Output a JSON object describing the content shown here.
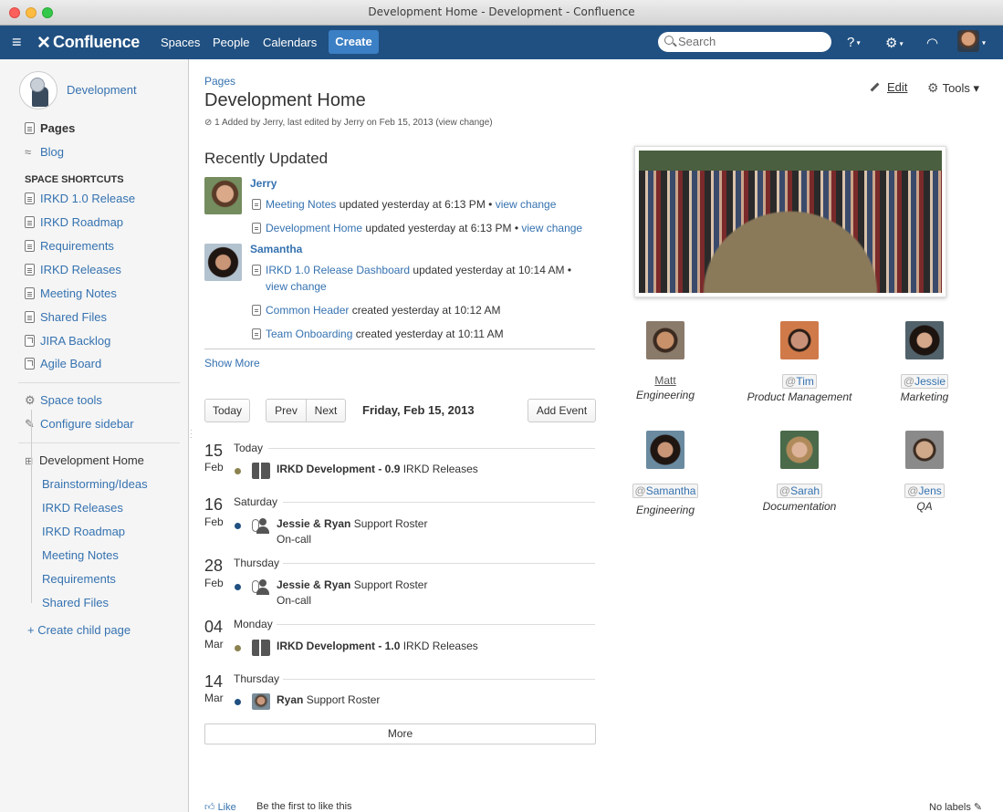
{
  "window": {
    "title": "Development Home - Development - Confluence"
  },
  "topnav": {
    "logo": "Confluence",
    "items": [
      "Spaces",
      "People",
      "Calendars"
    ],
    "create": "Create",
    "search_placeholder": "Search"
  },
  "sidebar": {
    "space_name": "Development",
    "pages": "Pages",
    "blog": "Blog",
    "shortcuts_heading": "SPACE SHORTCUTS",
    "shortcuts": [
      "IRKD 1.0 Release",
      "IRKD Roadmap",
      "Requirements",
      "IRKD Releases",
      "Meeting Notes",
      "Shared Files",
      "JIRA Backlog",
      "Agile Board"
    ],
    "space_tools": "Space tools",
    "configure_sidebar": "Configure sidebar",
    "tree_root": "Development Home",
    "tree_children": [
      "Brainstorming/Ideas",
      "IRKD Releases",
      "IRKD Roadmap",
      "Meeting Notes",
      "Requirements",
      "Shared Files"
    ],
    "create_child": "+ Create child page"
  },
  "page": {
    "breadcrumb": "Pages",
    "title": "Development Home",
    "meta": "1 Added by Jerry, last edited by Jerry on Feb 15, 2013  (view change)",
    "edit": "Edit",
    "tools": "Tools ▾"
  },
  "recently_updated": {
    "title": "Recently Updated",
    "show_more": "Show More",
    "users": [
      {
        "name": "Jerry",
        "entries": [
          {
            "link": "Meeting Notes",
            "text": " updated yesterday at 6:13 PM • ",
            "change": "view change"
          },
          {
            "link": "Development Home",
            "text": " updated yesterday at 6:13 PM • ",
            "change": "view change"
          }
        ]
      },
      {
        "name": "Samantha",
        "entries": [
          {
            "link": "IRKD 1.0 Release Dashboard",
            "text": " updated yesterday at 10:14 AM •",
            "change": "view change"
          },
          {
            "link": "Common Header",
            "text": " created yesterday at 10:12 AM",
            "change": ""
          },
          {
            "link": "Team Onboarding",
            "text": " created yesterday at 10:11 AM",
            "change": ""
          }
        ]
      }
    ]
  },
  "calendar": {
    "today_btn": "Today",
    "prev_btn": "Prev",
    "next_btn": "Next",
    "current_date": "Friday, Feb 15, 2013",
    "add_event": "Add Event",
    "more": "More",
    "events": [
      {
        "day": "15",
        "month": "Feb",
        "dow": "Today",
        "title": "IRKD Development - 0.9",
        "calendar": "IRKD Releases",
        "sub": "",
        "dot": "#8b8250"
      },
      {
        "day": "16",
        "month": "Feb",
        "dow": "Saturday",
        "title": "Jessie & Ryan",
        "calendar": "Support Roster",
        "sub": "On-call",
        "dot": "#205081"
      },
      {
        "day": "28",
        "month": "Feb",
        "dow": "Thursday",
        "title": "Jessie & Ryan",
        "calendar": "Support Roster",
        "sub": "On-call",
        "dot": "#205081"
      },
      {
        "day": "04",
        "month": "Mar",
        "dow": "Monday",
        "title": "IRKD Development - 1.0",
        "calendar": "IRKD Releases",
        "sub": "",
        "dot": "#8b8250"
      },
      {
        "day": "14",
        "month": "Mar",
        "dow": "Thursday",
        "title": "Ryan",
        "calendar": "Support Roster",
        "sub": "",
        "dot": "#205081"
      }
    ]
  },
  "team": [
    {
      "name": "Matt",
      "mention": false,
      "role": "Engineering"
    },
    {
      "name": "Tim",
      "mention": true,
      "role": "Product Management"
    },
    {
      "name": "Jessie",
      "mention": true,
      "role": "Marketing"
    },
    {
      "name": "Samantha",
      "mention": true,
      "role": "Engineering"
    },
    {
      "name": "Sarah",
      "mention": true,
      "role": "Documentation"
    },
    {
      "name": "Jens",
      "mention": true,
      "role": "QA"
    }
  ],
  "footer": {
    "like": "Like",
    "like_text": "Be the first to like this",
    "labels": "No labels"
  }
}
